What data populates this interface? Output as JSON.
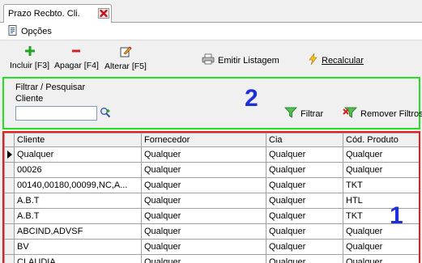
{
  "tab": {
    "label": "Prazo Recbto. Cli."
  },
  "menu": {
    "options_label": "Opções"
  },
  "toolbar": {
    "include_label": "Incluir [F3]",
    "delete_label": "Apagar [F4]",
    "edit_label": "Alterar [F5]",
    "print_label": "Emitir Listagem",
    "recalc_label": "Recalcular"
  },
  "filter": {
    "title": "Filtrar / Pesquisar",
    "client_label": "Cliente",
    "client_value": "",
    "filter_label": "Filtrar",
    "remove_label": "Remover Filtros",
    "annotation": "2"
  },
  "grid": {
    "columns": [
      "Cliente",
      "Fornecedor",
      "Cia",
      "Cód. Produto"
    ],
    "rows": [
      [
        "Qualquer",
        "Qualquer",
        "Qualquer",
        "Qualquer"
      ],
      [
        "00026",
        "Qualquer",
        "Qualquer",
        "Qualquer"
      ],
      [
        "00140,00180,00099,NC,A...",
        "Qualquer",
        "Qualquer",
        "TKT"
      ],
      [
        "A.B.T",
        "Qualquer",
        "Qualquer",
        "HTL"
      ],
      [
        "A.B.T",
        "Qualquer",
        "Qualquer",
        "TKT"
      ],
      [
        "ABCIND,ADVSF",
        "Qualquer",
        "Qualquer",
        "Qualquer"
      ],
      [
        "BV",
        "Qualquer",
        "Qualquer",
        "Qualquer"
      ],
      [
        "CLAUDIA",
        "Qualquer",
        "Qualquer",
        "Qualquer"
      ]
    ],
    "annotation": "1"
  }
}
